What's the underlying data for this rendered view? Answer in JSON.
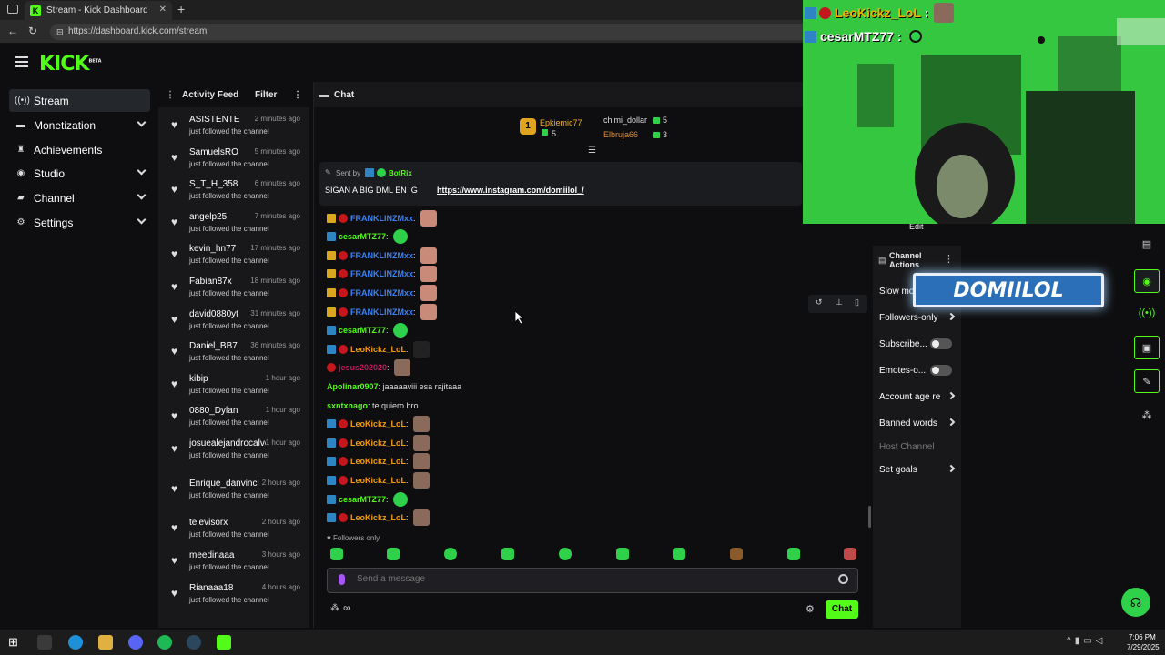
{
  "browser": {
    "tab_title": "Stream - Kick Dashboard",
    "url": "https://dashboard.kick.com/stream",
    "new_tab": "+",
    "close": "✕"
  },
  "brand": {
    "logo": "KICK",
    "beta": "BETA",
    "accent": "#53fc18"
  },
  "sidebar": {
    "items": [
      {
        "label": "Stream",
        "icon": "broadcast-icon",
        "active": true
      },
      {
        "label": "Monetization",
        "icon": "money-icon",
        "expandable": true
      },
      {
        "label": "Achievements",
        "icon": "trophy-icon"
      },
      {
        "label": "Studio",
        "icon": "camera-icon",
        "expandable": true
      },
      {
        "label": "Channel",
        "icon": "user-icon",
        "expandable": true
      },
      {
        "label": "Settings",
        "icon": "gear-icon",
        "expandable": true
      }
    ]
  },
  "feed": {
    "title": "Activity Feed",
    "filter": "Filter",
    "action": "just followed the channel",
    "items": [
      {
        "name": "ASISTENTE",
        "time": "2 minutes ago"
      },
      {
        "name": "SamuelsRO",
        "time": "5 minutes ago"
      },
      {
        "name": "S_T_H_358",
        "time": "6 minutes ago"
      },
      {
        "name": "angelp25",
        "time": "7 minutes ago"
      },
      {
        "name": "kevin_hn77",
        "time": "17 minutes ago"
      },
      {
        "name": "Fabian87x",
        "time": "18 minutes ago"
      },
      {
        "name": "david0880yt",
        "time": "31 minutes ago"
      },
      {
        "name": "Daniel_BB7",
        "time": "36 minutes ago"
      },
      {
        "name": "kibip",
        "time": "1 hour ago"
      },
      {
        "name": "0880_Dylan",
        "time": "1 hour ago"
      },
      {
        "name": "josuealejandrocalvo",
        "time": "1 hour ago"
      },
      {
        "name": "Enrique_danvinci",
        "time": "2 hours ago"
      },
      {
        "name": "televisorx",
        "time": "2 hours ago"
      },
      {
        "name": "meedinaaa",
        "time": "3 hours ago"
      },
      {
        "name": "Rianaaa18",
        "time": "4 hours ago"
      }
    ]
  },
  "chat": {
    "title": "Chat",
    "leaderboard": {
      "rank": "1",
      "first": {
        "name": "Epkiemic77",
        "count": "5"
      },
      "second": {
        "name": "chimi_dollar",
        "count": "5"
      },
      "third": {
        "name": "Elbruja66",
        "count": "3"
      }
    },
    "pinned": {
      "sent_by": "Sent by",
      "bot": "BotRix",
      "text": "SIGAN A BIG DML EN IG",
      "link": "https://www.instagram.com/domiilol_/"
    },
    "messages": [
      {
        "user": "FRANKLINZMxx",
        "color": "#3b82f6",
        "badges": [
          "crown",
          "red"
        ],
        "text": "",
        "emote": "hand"
      },
      {
        "user": "cesarMTZ77",
        "color": "#53fc18",
        "badges": [
          "mod"
        ],
        "text": "",
        "emote": "green"
      },
      {
        "user": "FRANKLINZMxx",
        "color": "#3b82f6",
        "badges": [
          "crown",
          "red"
        ],
        "text": "",
        "emote": "hand"
      },
      {
        "user": "FRANKLINZMxx",
        "color": "#3b82f6",
        "badges": [
          "crown",
          "red"
        ],
        "text": "",
        "emote": "hand"
      },
      {
        "user": "FRANKLINZMxx",
        "color": "#3b82f6",
        "badges": [
          "crown",
          "red"
        ],
        "text": "",
        "emote": "hand"
      },
      {
        "user": "FRANKLINZMxx",
        "color": "#3b82f6",
        "badges": [
          "crown",
          "red"
        ],
        "text": "",
        "emote": "hand"
      },
      {
        "user": "cesarMTZ77",
        "color": "#53fc18",
        "badges": [
          "mod"
        ],
        "text": "",
        "emote": "green"
      },
      {
        "user": "LeoKickz_LoL",
        "color": "#f39c12",
        "badges": [
          "mod",
          "red"
        ],
        "text": "",
        "emote": "dark"
      },
      {
        "user": "jesus202020",
        "color": "#c2185b",
        "badges": [
          "red"
        ],
        "text": "",
        "emote": "face"
      },
      {
        "user": "Apolinar0907",
        "color": "#53fc18",
        "badges": [],
        "text": "jaaaaaviii esa rajitaaa",
        "emote": ""
      },
      {
        "user": "sxntxnago",
        "color": "#53fc18",
        "badges": [],
        "text": "te quiero bro",
        "emote": ""
      },
      {
        "user": "LeoKickz_LoL",
        "color": "#f39c12",
        "badges": [
          "mod",
          "red"
        ],
        "text": "",
        "emote": "face"
      },
      {
        "user": "LeoKickz_LoL",
        "color": "#f39c12",
        "badges": [
          "mod",
          "red"
        ],
        "text": "",
        "emote": "face"
      },
      {
        "user": "LeoKickz_LoL",
        "color": "#f39c12",
        "badges": [
          "mod",
          "red"
        ],
        "text": "",
        "emote": "face"
      },
      {
        "user": "LeoKickz_LoL",
        "color": "#f39c12",
        "badges": [
          "mod",
          "red"
        ],
        "text": "",
        "emote": "face"
      },
      {
        "user": "cesarMTZ77",
        "color": "#53fc18",
        "badges": [
          "mod"
        ],
        "text": "",
        "emote": "green"
      },
      {
        "user": "LeoKickz_LoL",
        "color": "#f39c12",
        "badges": [
          "mod",
          "red"
        ],
        "text": "",
        "emote": "face"
      }
    ],
    "followers_only": "Followers only",
    "placeholder": "Send a message",
    "send": "Chat",
    "infinity": "∞"
  },
  "channel_actions": {
    "title": "Channel Actions",
    "edit": "Edit",
    "items": [
      {
        "label": "Slow mo",
        "type": "none"
      },
      {
        "label": "Followers-only",
        "type": "arrow"
      },
      {
        "label": "Subscribe...",
        "type": "toggle"
      },
      {
        "label": "Emotes-o...",
        "type": "toggle"
      },
      {
        "label": "Account age re",
        "type": "arrow"
      },
      {
        "label": "Banned words",
        "type": "arrow"
      },
      {
        "label": "Host Channel",
        "type": "disabled"
      },
      {
        "label": "Set goals",
        "type": "arrow"
      }
    ]
  },
  "overlay": {
    "lines": [
      {
        "user": "LeoKickz_LoL"
      },
      {
        "user": "cesarMTZ77"
      }
    ],
    "banner": "DOMIILOL"
  },
  "taskbar": {
    "time": "7:06 PM",
    "date": "7/29/2025"
  }
}
